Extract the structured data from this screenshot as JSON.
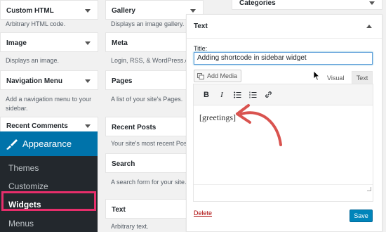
{
  "widgets": {
    "custom_html": {
      "title": "Custom HTML",
      "desc": "Arbitrary HTML code."
    },
    "gallery": {
      "title": "Gallery",
      "desc": "Displays an image gallery."
    },
    "image": {
      "title": "Image",
      "desc": "Displays an image."
    },
    "meta": {
      "title": "Meta",
      "desc": "Login, RSS, & WordPress.org"
    },
    "navigation_menu": {
      "title": "Navigation Menu",
      "desc_line1": "Add a navigation menu to your",
      "desc_line2": "sidebar."
    },
    "pages": {
      "title": "Pages",
      "desc": "A list of your site's Pages."
    },
    "recent_comments": {
      "title": "Recent Comments"
    },
    "recent_posts": {
      "title": "Recent Posts",
      "desc": "Your site's most recent Posts."
    },
    "search": {
      "title": "Search",
      "desc": "A search form for your site."
    },
    "text": {
      "title": "Text",
      "desc": "Arbitrary text."
    }
  },
  "sidebar_area": {
    "title": "Categories"
  },
  "admin_menu": {
    "appearance": "Appearance",
    "items": [
      "Themes",
      "Customize",
      "Widgets",
      "Menus"
    ],
    "current": "Widgets",
    "accent": "#0073aa",
    "highlight": "#e62e6b"
  },
  "text_widget": {
    "title": "Text",
    "title_label": "Title:",
    "title_value": "Adding shortcode in sidebar widget",
    "add_media": "Add Media",
    "tab_visual": "Visual",
    "tab_text": "Text",
    "toolbar_icons": [
      "bold-icon",
      "italic-icon",
      "bulleted-list-icon",
      "numbered-list-icon",
      "link-icon"
    ],
    "content": "[greetings]",
    "delete": "Delete",
    "save": "Save"
  }
}
